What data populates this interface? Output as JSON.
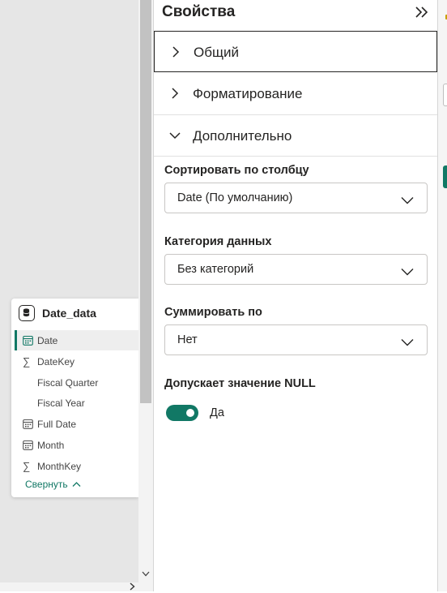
{
  "colors": {
    "accent": "#117865",
    "canvas_bg": "#e6e6e6",
    "text": "#252423"
  },
  "table_card": {
    "title": "Date_data",
    "icon": "database-icon",
    "fields": [
      {
        "label": "Date",
        "icon": "calendar-icon",
        "selected": true
      },
      {
        "label": "DateKey",
        "icon": "sigma-icon",
        "selected": false
      },
      {
        "label": "Fiscal Quarter",
        "icon": "",
        "selected": false
      },
      {
        "label": "Fiscal Year",
        "icon": "",
        "selected": false
      },
      {
        "label": "Full Date",
        "icon": "calendar-icon",
        "selected": false
      },
      {
        "label": "Month",
        "icon": "calendar-icon",
        "selected": false
      },
      {
        "label": "MonthKey",
        "icon": "sigma-icon",
        "selected": false
      }
    ],
    "collapse_label": "Свернуть"
  },
  "properties": {
    "title": "Свойства",
    "sections": {
      "general": "Общий",
      "formatting": "Форматирование",
      "advanced": "Дополнительно"
    },
    "sort_by_column": {
      "label": "Сортировать по столбцу",
      "value": "Date (По умолчанию)"
    },
    "data_category": {
      "label": "Категория данных",
      "value": "Без категорий"
    },
    "summarize_by": {
      "label": "Суммировать по",
      "value": "Нет"
    },
    "nullable": {
      "label": "Допускает значение NULL",
      "toggle_on": true,
      "toggle_text": "Да"
    }
  }
}
